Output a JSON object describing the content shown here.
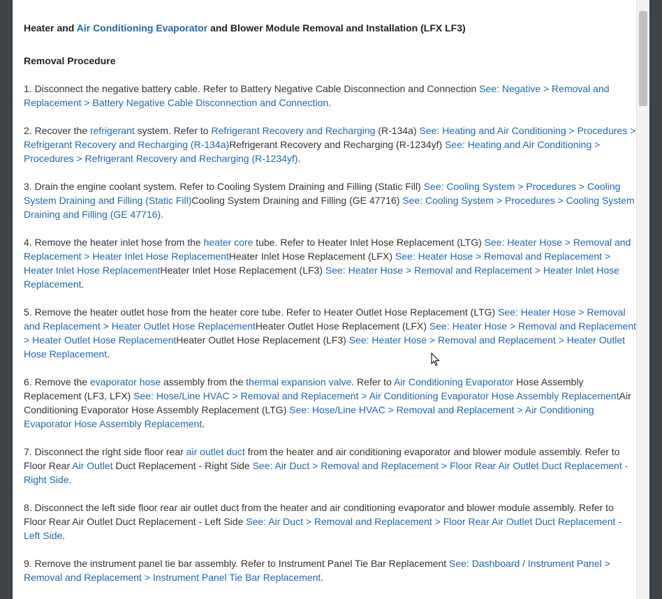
{
  "doc": {
    "title_parts": [
      {
        "text": "Heater and "
      },
      {
        "text": "Air Conditioning Evaporator",
        "link": true
      },
      {
        "text": " and Blower Module Removal and Installation (LFX LF3)"
      }
    ],
    "section": "Removal Procedure",
    "steps": [
      [
        {
          "text": "1. Disconnect the negative battery cable. Refer to Battery Negative Cable Disconnection and Connection "
        },
        {
          "text": "See: Negative > Removal and Replacement > Battery Negative Cable Disconnection and Connection",
          "link": true
        },
        {
          "text": "."
        }
      ],
      [
        {
          "text": "2. Recover the "
        },
        {
          "text": "refrigerant",
          "link": true
        },
        {
          "text": " system. Refer to "
        },
        {
          "text": "Refrigerant Recovery and Recharging",
          "link": true
        },
        {
          "text": " (R-134a) "
        },
        {
          "text": "See: Heating and Air Conditioning > Procedures > Refrigerant Recovery and Recharging (R-134a)",
          "link": true
        },
        {
          "text": "Refrigerant Recovery and Recharging (R-1234yf) "
        },
        {
          "text": "See: Heating and Air Conditioning > Procedures > Refrigerant Recovery and Recharging (R-1234yf)",
          "link": true
        },
        {
          "text": "."
        }
      ],
      [
        {
          "text": "3. Drain the engine coolant system. Refer to Cooling System Draining and Filling (Static Fill) "
        },
        {
          "text": "See: Cooling System > Procedures > Cooling System Draining and Filling (Static Fill)",
          "link": true
        },
        {
          "text": "Cooling System Draining and Filling (GE 47716) "
        },
        {
          "text": "See: Cooling System > Procedures > Cooling System Draining and Filling (GE 47716)",
          "link": true
        },
        {
          "text": "."
        }
      ],
      [
        {
          "text": "4. Remove the heater inlet hose from the "
        },
        {
          "text": "heater core",
          "link": true
        },
        {
          "text": " tube. Refer to Heater Inlet Hose Replacement (LTG) "
        },
        {
          "text": "See: Heater Hose > Removal and Replacement > Heater Inlet Hose Replacement",
          "link": true
        },
        {
          "text": "Heater Inlet Hose Replacement (LFX) "
        },
        {
          "text": "See: Heater Hose > Removal and Replacement > Heater Inlet Hose Replacement",
          "link": true
        },
        {
          "text": "Heater Inlet Hose Replacement (LF3) "
        },
        {
          "text": "See: Heater Hose > Removal and Replacement > Heater Inlet Hose Replacement",
          "link": true
        },
        {
          "text": "."
        }
      ],
      [
        {
          "text": "5. Remove the heater outlet hose from the heater core tube. Refer to Heater Outlet Hose Replacement (LTG) "
        },
        {
          "text": "See: Heater Hose > Removal and Replacement > Heater Outlet Hose Replacement",
          "link": true
        },
        {
          "text": "Heater Outlet Hose Replacement (LFX) "
        },
        {
          "text": "See: Heater Hose > Removal and Replacement > Heater Outlet Hose Replacement",
          "link": true
        },
        {
          "text": "Heater Outlet Hose Replacement (LF3) "
        },
        {
          "text": "See: Heater Hose > Removal and Replacement > Heater Outlet Hose Replacement",
          "link": true
        },
        {
          "text": "."
        }
      ],
      [
        {
          "text": "6. Remove the "
        },
        {
          "text": "evaporator hose",
          "link": true
        },
        {
          "text": " assembly from the "
        },
        {
          "text": "thermal expansion valve",
          "link": true
        },
        {
          "text": ". Refer to "
        },
        {
          "text": "Air Conditioning Evaporator",
          "link": true
        },
        {
          "text": " Hose Assembly Replacement (LF3, LFX) "
        },
        {
          "text": "See: Hose/Line HVAC > Removal and Replacement > Air Conditioning Evaporator Hose Assembly Replacement",
          "link": true
        },
        {
          "text": "Air Conditioning Evaporator Hose Assembly Replacement (LTG) "
        },
        {
          "text": "See: Hose/Line HVAC > Removal and Replacement > Air Conditioning Evaporator Hose Assembly Replacement",
          "link": true
        },
        {
          "text": "."
        }
      ],
      [
        {
          "text": "7. Disconnect the right side floor rear "
        },
        {
          "text": "air outlet duct",
          "link": true
        },
        {
          "text": " from the heater and air conditioning evaporator and blower module assembly. Refer to Floor Rear "
        },
        {
          "text": "Air Outlet",
          "link": true
        },
        {
          "text": " Duct Replacement - Right Side "
        },
        {
          "text": "See: Air Duct > Removal and Replacement > Floor Rear Air Outlet Duct Replacement - Right Side",
          "link": true
        },
        {
          "text": "."
        }
      ],
      [
        {
          "text": "8. Disconnect the left side floor rear air outlet duct from the heater and air conditioning evaporator and blower module assembly. Refer to Floor Rear Air Outlet Duct Replacement - Left Side "
        },
        {
          "text": "See: Air Duct > Removal and Replacement > Floor Rear Air Outlet Duct Replacement - Left Side",
          "link": true
        },
        {
          "text": "."
        }
      ],
      [
        {
          "text": "9. Remove the instrument panel tie bar assembly. Refer to Instrument Panel Tie Bar Replacement "
        },
        {
          "text": "See: Dashboard / Instrument Panel > Removal and Replacement > Instrument Panel Tie Bar Replacement",
          "link": true
        },
        {
          "text": "."
        }
      ]
    ]
  },
  "colors": {
    "link": "#1f67b1",
    "text": "#333333",
    "page_bg": "#ffffff",
    "backdrop": "#3f4449"
  }
}
